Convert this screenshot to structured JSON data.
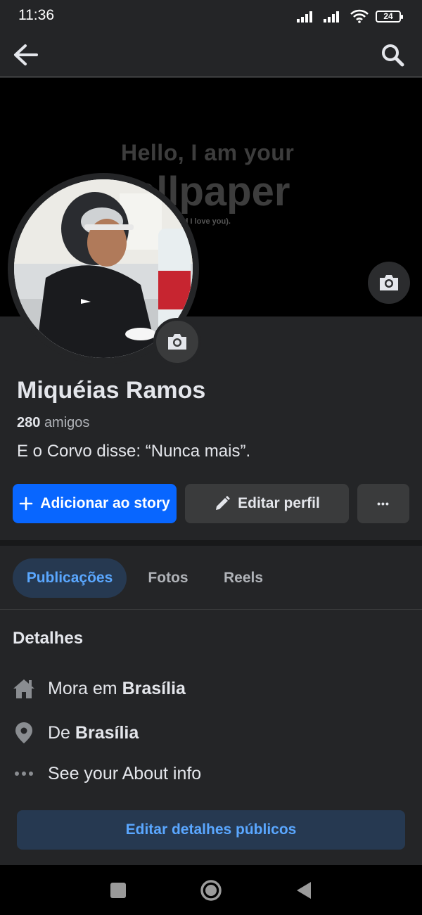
{
  "status": {
    "time": "11:36",
    "battery": "24"
  },
  "cover": {
    "line1": "Hello, I am your",
    "line2": "allpaper",
    "line3": "nd I love you)."
  },
  "profile": {
    "name": "Miquéias Ramos",
    "friends_count": "280",
    "friends_label": "amigos",
    "bio": "E o Corvo disse: “Nunca mais”."
  },
  "actions": {
    "add_story": "Adicionar ao story",
    "edit_profile": "Editar perfil",
    "more": "•••"
  },
  "tabs": [
    {
      "label": "Publicações",
      "active": true
    },
    {
      "label": "Fotos",
      "active": false
    },
    {
      "label": "Reels",
      "active": false
    }
  ],
  "details": {
    "title": "Detalhes",
    "lives_prefix": "Mora em",
    "lives_city": "Brasília",
    "from_prefix": "De",
    "from_city": "Brasília",
    "about_link": "See your About info",
    "edit_public": "Editar detalhes públicos"
  },
  "colors": {
    "accent": "#0866ff",
    "link": "#5aa7ff",
    "background": "#242527"
  }
}
